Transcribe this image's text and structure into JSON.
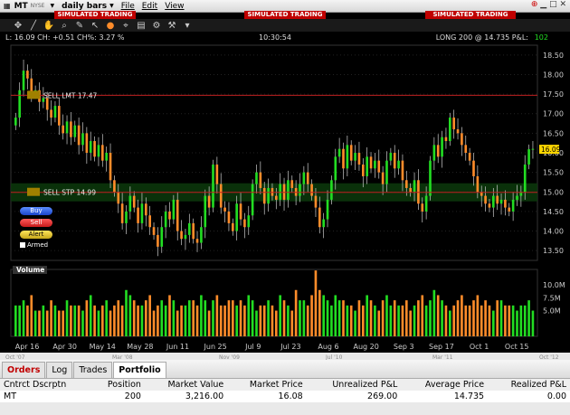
{
  "header": {
    "symbol": "MT",
    "exchange": "NYSE",
    "period": "daily bars",
    "menus": [
      "File",
      "Edit",
      "View"
    ],
    "sim_banner": "SIMULATED TRADING"
  },
  "info": {
    "left": "L: 16.09  CH: +0.51  CH%: 3.27 %",
    "time": "10:30:54",
    "position_label": "LONG 200 @ 14.735  P&L:",
    "pnl": "102"
  },
  "orders": [
    {
      "label": "SELL LMT 17.47",
      "price": 17.47
    },
    {
      "label": "SELL STP 14.99",
      "price": 14.99
    }
  ],
  "current_price_label": "16.09",
  "buttons": {
    "buy": "Buy",
    "sell": "Sell",
    "alert": "Alert",
    "armed": "Armed"
  },
  "volume_label": "Volume",
  "colors": {
    "up": "#22dd22",
    "down": "#ff8c2a",
    "sim": "#c00000"
  },
  "chart_data": {
    "type": "candlestick",
    "price_ticks": [
      "18.50",
      "18.00",
      "17.50",
      "17.00",
      "16.50",
      "16.00",
      "15.50",
      "15.00",
      "14.50",
      "14.00",
      "13.50"
    ],
    "price_range": [
      13.25,
      18.75
    ],
    "volume_ticks": [
      "10.0M",
      "7.5M",
      "5.0M"
    ],
    "volume_range": [
      0,
      13
    ],
    "x_labels": [
      "Apr 16",
      "Apr 30",
      "May 14",
      "May 28",
      "Jun 11",
      "Jun 25",
      "Jul 9",
      "Jul 23",
      "Aug 6",
      "Aug 20",
      "Sep 3",
      "Sep 17",
      "Oct 1",
      "Oct 15"
    ],
    "bar_count": 132,
    "closes": [
      16.9,
      17.6,
      18.1,
      17.9,
      17.5,
      17.6,
      17.3,
      17.4,
      17.1,
      16.9,
      17.2,
      16.7,
      16.5,
      16.8,
      16.4,
      16.7,
      16.2,
      16.5,
      16.0,
      16.3,
      15.9,
      16.2,
      15.8,
      16.0,
      15.3,
      15.0,
      14.7,
      14.2,
      14.5,
      14.9,
      14.6,
      14.2,
      14.7,
      14.4,
      14.1,
      13.9,
      13.6,
      14.1,
      14.5,
      14.3,
      14.8,
      14.0,
      13.8,
      13.9,
      14.2,
      13.8,
      13.7,
      14.1,
      14.9,
      14.6,
      15.7,
      15.2,
      14.6,
      14.5,
      14.2,
      14.0,
      14.7,
      14.3,
      14.1,
      14.4,
      15.2,
      15.5,
      15.1,
      14.7,
      15.1,
      14.9,
      14.8,
      15.2,
      14.8,
      15.3,
      15.1,
      14.9,
      15.2,
      15.5,
      15.2,
      14.9,
      14.6,
      14.1,
      14.3,
      14.8,
      15.3,
      15.9,
      16.1,
      15.6,
      16.2,
      15.8,
      16.0,
      15.7,
      15.4,
      15.9,
      15.6,
      15.8,
      15.5,
      15.2,
      15.8,
      16.0,
      15.6,
      15.8,
      15.3,
      15.1,
      15.0,
      15.3,
      14.7,
      14.5,
      14.9,
      15.8,
      16.2,
      15.9,
      16.4,
      16.3,
      16.9,
      16.6,
      16.5,
      16.2,
      16.0,
      15.8,
      15.4,
      15.0,
      14.9,
      14.7,
      14.6,
      14.9,
      14.7,
      14.8,
      14.6,
      14.5,
      14.8,
      14.9,
      15.0,
      15.7,
      16.09,
      16.1
    ],
    "volumes": [
      6,
      6,
      7,
      6,
      8,
      5,
      5,
      6,
      5,
      7,
      6,
      5,
      5,
      7,
      6,
      6,
      6,
      5,
      7,
      8,
      6,
      5,
      6,
      7,
      5,
      6,
      7,
      6,
      9,
      8,
      7,
      6,
      6,
      7,
      8,
      5,
      6,
      7,
      6,
      8,
      7,
      5,
      6,
      6,
      7,
      7,
      6,
      8,
      7,
      5,
      7,
      8,
      6,
      6,
      7,
      7,
      6,
      7,
      6,
      8,
      7,
      5,
      6,
      6,
      7,
      6,
      5,
      8,
      7,
      6,
      5,
      9,
      7,
      7,
      6,
      8,
      12.8,
      9,
      8,
      7,
      6,
      8,
      7,
      7,
      6,
      6,
      5,
      7,
      6,
      8,
      7,
      6,
      5,
      7,
      8,
      6,
      7,
      6,
      6,
      7,
      5,
      6,
      7,
      8,
      6,
      7,
      9,
      8,
      7,
      6,
      5,
      6,
      7,
      8,
      6,
      6,
      7,
      8,
      6,
      7,
      6,
      5,
      7,
      7,
      6,
      6,
      6,
      5,
      6,
      6,
      7,
      5
    ],
    "years": [
      "Oct '07",
      "Mar '08",
      "Nov '09",
      "Jul '10",
      "Mar '11",
      "Oct '12"
    ]
  },
  "portfolio": {
    "tabs": [
      "Orders",
      "Log",
      "Trades",
      "Portfolio"
    ],
    "columns": [
      "Cntrct Dscrptn",
      "Position",
      "Market Value",
      "Market Price",
      "Unrealized P&L",
      "Average Price",
      "Realized P&L"
    ],
    "rows": [
      [
        "MT",
        "200",
        "3,216.00",
        "16.08",
        "269.00",
        "14.735",
        "0.00"
      ]
    ]
  }
}
